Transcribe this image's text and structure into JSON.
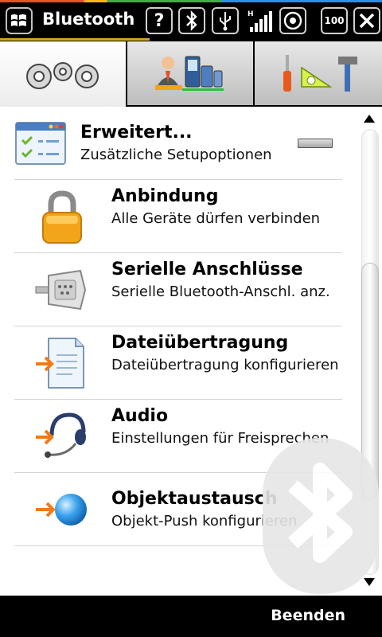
{
  "app": {
    "title": "Bluetooth"
  },
  "statusbar": {
    "icons": [
      "windows-start-icon",
      "help-icon",
      "bluetooth-icon",
      "usb-icon",
      "signal-icon",
      "media-icon",
      "battery-icon",
      "close-icon"
    ],
    "battery_label": "100"
  },
  "tabs": [
    {
      "icon": "gears-icon",
      "active": true
    },
    {
      "icon": "devices-icon",
      "active": false
    },
    {
      "icon": "tools-icon",
      "active": false
    }
  ],
  "items": [
    {
      "title": "Erweitert...",
      "desc": "Zusätzliche Setupoptionen",
      "icon": "advanced-settings-icon",
      "has_toggle": true
    },
    {
      "title": "Anbindung",
      "desc": "Alle Geräte dürfen verbinden",
      "icon": "padlock-icon"
    },
    {
      "title": "Serielle Anschlüsse",
      "desc": "Serielle Bluetooth-Anschl. anz.",
      "icon": "serial-port-icon"
    },
    {
      "title": "Dateiübertragung",
      "desc": "Dateiübertragung konfigurieren",
      "icon": "file-transfer-icon"
    },
    {
      "title": "Audio",
      "desc": "Einstellungen für Freisprechen",
      "icon": "headset-icon"
    },
    {
      "title": "Objektaustausch",
      "desc": "Objekt-Push konfigurieren",
      "icon": "object-push-icon"
    }
  ],
  "softkeys": {
    "right": "Beenden"
  },
  "colors": {
    "accent_arrow": "#f07b16",
    "lock_gold": "#f2a51a",
    "bar_bg": "#000000"
  }
}
